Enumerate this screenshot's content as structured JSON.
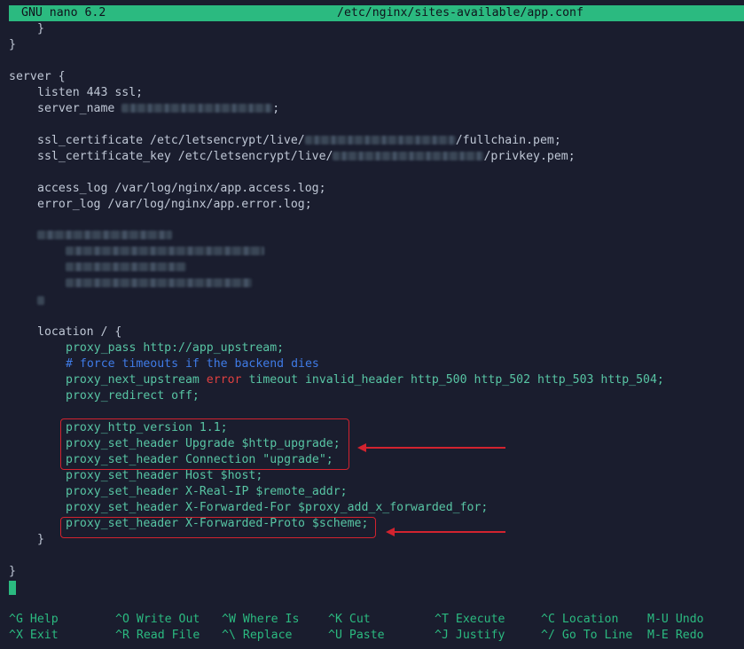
{
  "titlebar": {
    "app": "GNU nano 6.2",
    "file": "/etc/nginx/sites-available/app.conf"
  },
  "lines": {
    "l1": "}",
    "l2": "}",
    "l3": "server {",
    "l4_a": "listen 443 ssl;",
    "l5_a": "server_name ",
    "l5_b": ";",
    "l6_a": "ssl_certificate /etc/letsencrypt/live/",
    "l6_b": "/fullchain.pem;",
    "l7_a": "ssl_certificate_key /etc/letsencrypt/live/",
    "l7_b": "/privkey.pem;",
    "l8": "access_log /var/log/nginx/app.access.log;",
    "l9": "error_log /var/log/nginx/app.error.log;",
    "l10": "location / {",
    "l11": "proxy_pass http://app_upstream;",
    "l12": "# force timeouts if the backend dies",
    "l13_a": "proxy_next_upstream ",
    "l13_err": "error",
    "l13_b": " timeout invalid_header http_500 http_502 http_503 http_504;",
    "l14": "proxy_redirect off;",
    "l15": "proxy_http_version 1.1;",
    "l16": "proxy_set_header Upgrade $http_upgrade;",
    "l17": "proxy_set_header Connection \"upgrade\";",
    "l18": "proxy_set_header Host $host;",
    "l19": "proxy_set_header X-Real-IP $remote_addr;",
    "l20": "proxy_set_header X-Forwarded-For $proxy_add_x_forwarded_for;",
    "l21": "proxy_set_header X-Forwarded-Proto $scheme;",
    "l22": "}",
    "l23": "}"
  },
  "shortcuts": [
    {
      "key": "^G",
      "label": "Help"
    },
    {
      "key": "^X",
      "label": "Exit"
    },
    {
      "key": "^O",
      "label": "Write Out"
    },
    {
      "key": "^R",
      "label": "Read File"
    },
    {
      "key": "^W",
      "label": "Where Is"
    },
    {
      "key": "^\\",
      "label": "Replace"
    },
    {
      "key": "^K",
      "label": "Cut"
    },
    {
      "key": "^U",
      "label": "Paste"
    },
    {
      "key": "^T",
      "label": "Execute"
    },
    {
      "key": "^J",
      "label": "Justify"
    },
    {
      "key": "^C",
      "label": "Location"
    },
    {
      "key": "^/",
      "label": "Go To Line"
    },
    {
      "key": "M-U",
      "label": "Undo"
    },
    {
      "key": "M-E",
      "label": "Redo"
    }
  ],
  "colors": {
    "background": "#1a1d2e",
    "titlebar": "#2bba80",
    "directive": "#58c5a4",
    "comment": "#3f7be6",
    "error_keyword": "#e04040",
    "annotation": "#d2232f"
  }
}
